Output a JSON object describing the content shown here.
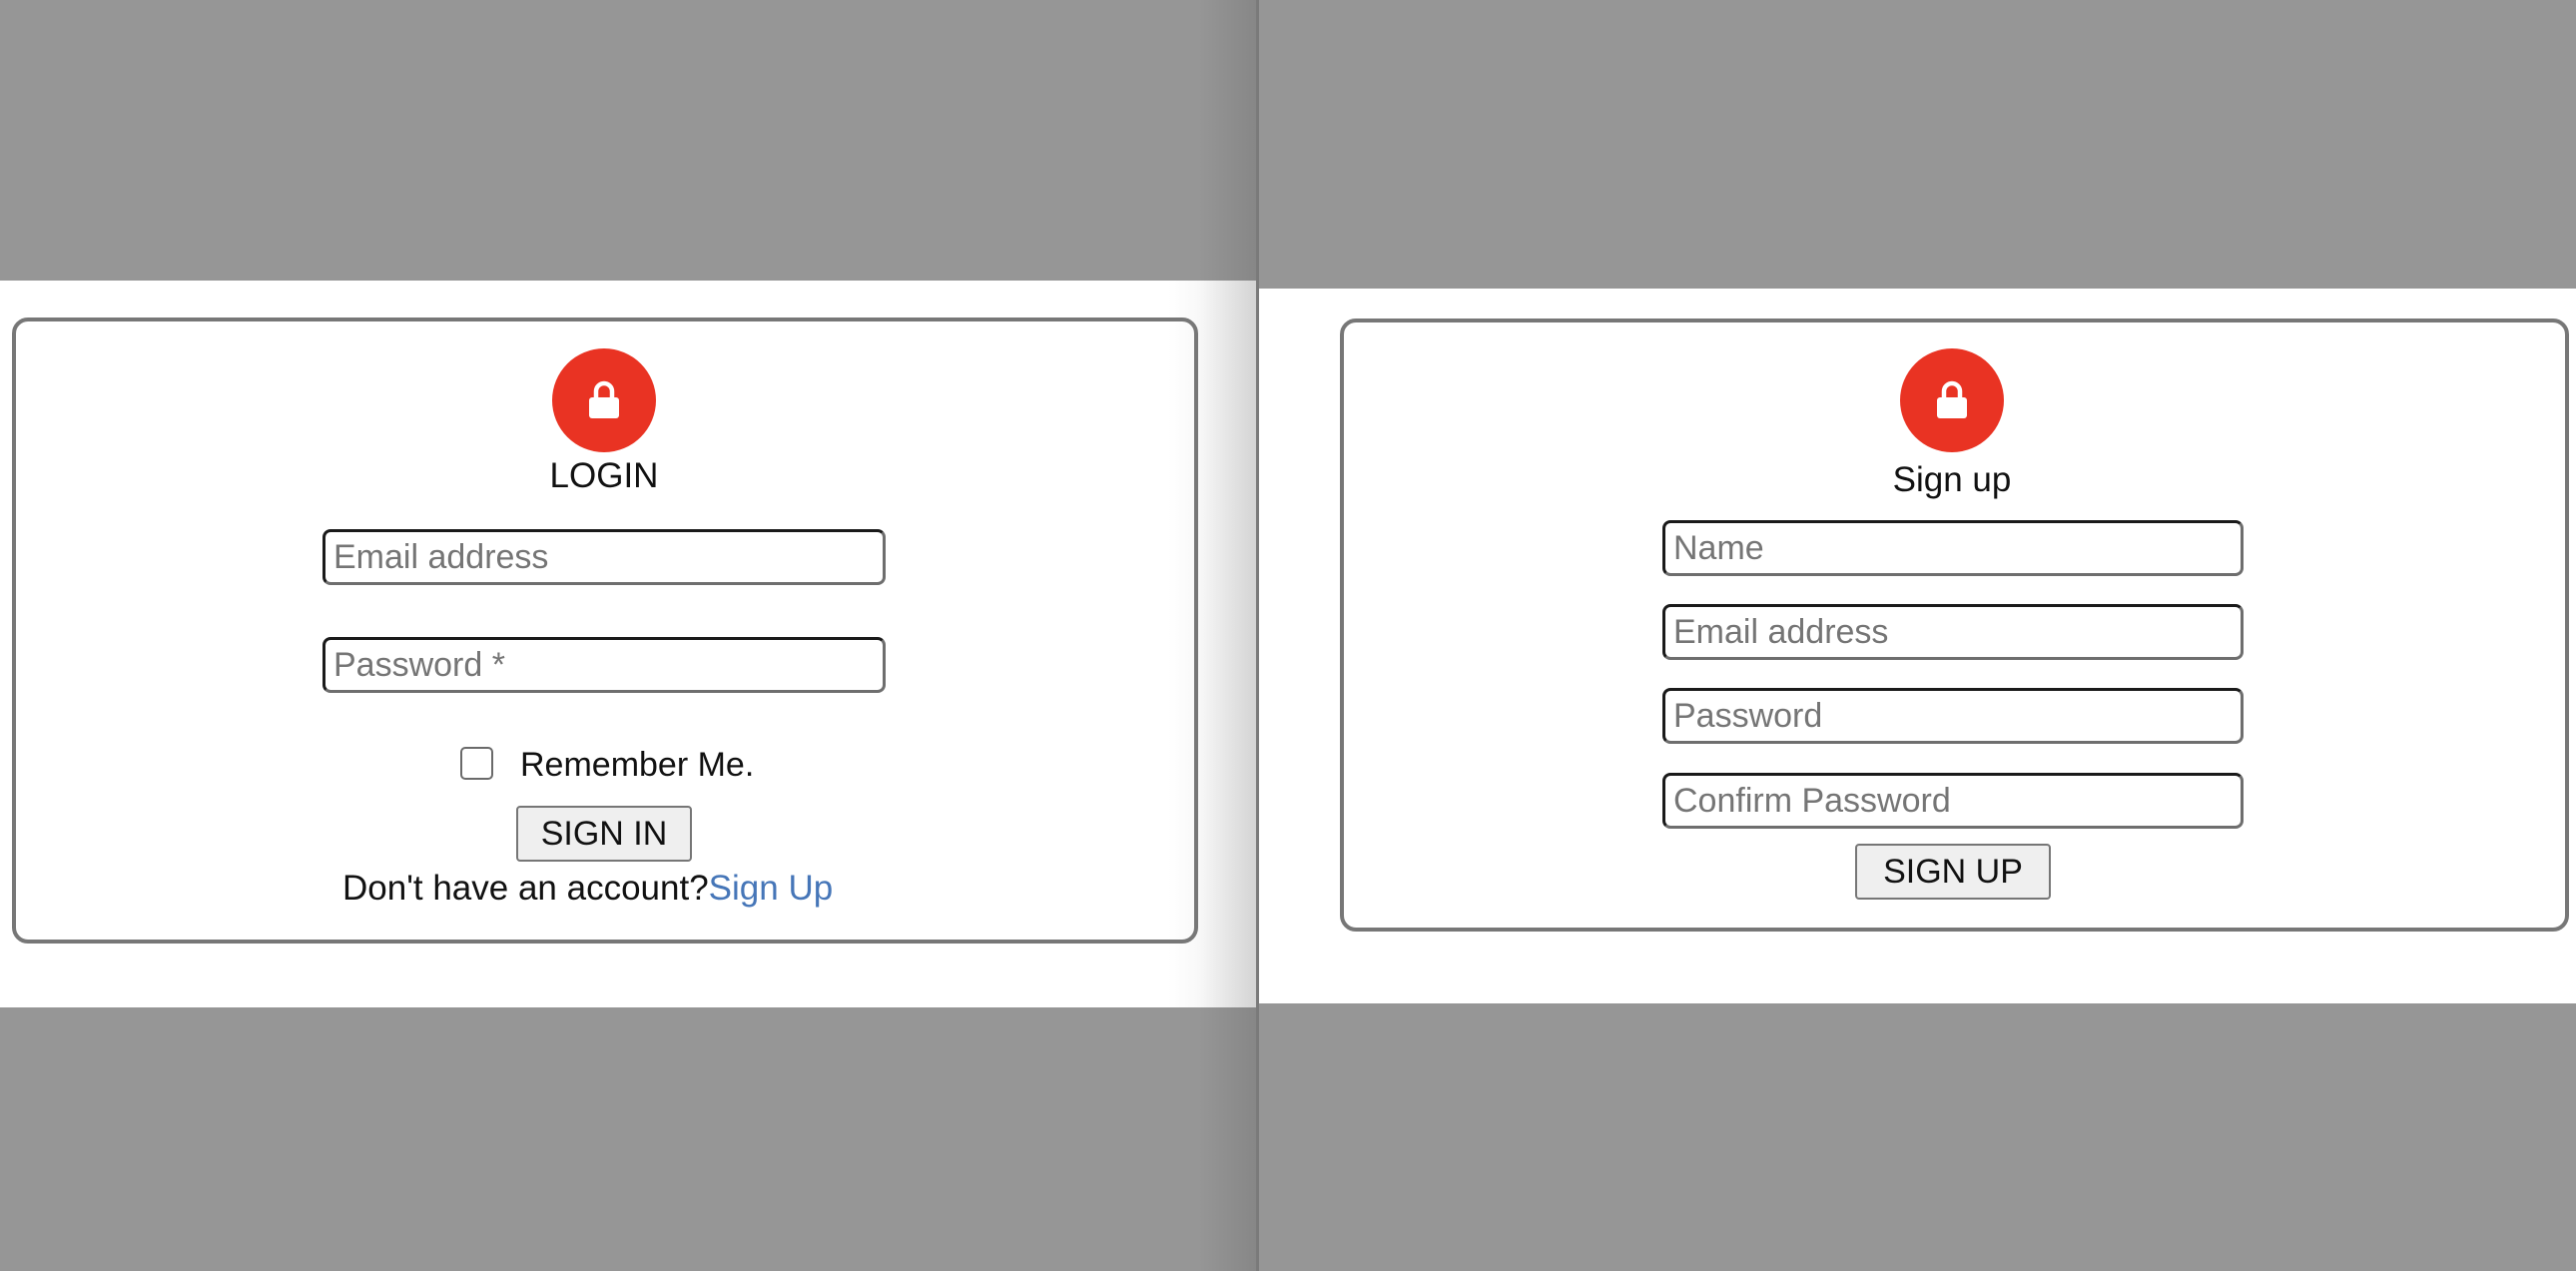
{
  "login": {
    "heading": "LOGIN",
    "email_placeholder": "Email address",
    "password_placeholder": "Password *",
    "remember_label": "Remember Me.",
    "remember_checked": false,
    "submit_label": "SIGN IN",
    "footer_prompt": "Don't have an account?",
    "footer_link": "Sign Up",
    "icon": "lock-icon"
  },
  "signup": {
    "heading": "Sign up",
    "name_placeholder": "Name",
    "email_placeholder": "Email address",
    "password_placeholder": "Password",
    "confirm_placeholder": "Confirm Password",
    "submit_label": "SIGN UP",
    "icon": "lock-icon"
  },
  "colors": {
    "avatar_bg": "#e93323",
    "link": "#4676b8",
    "backdrop": "#969696",
    "card_border": "#777777"
  }
}
